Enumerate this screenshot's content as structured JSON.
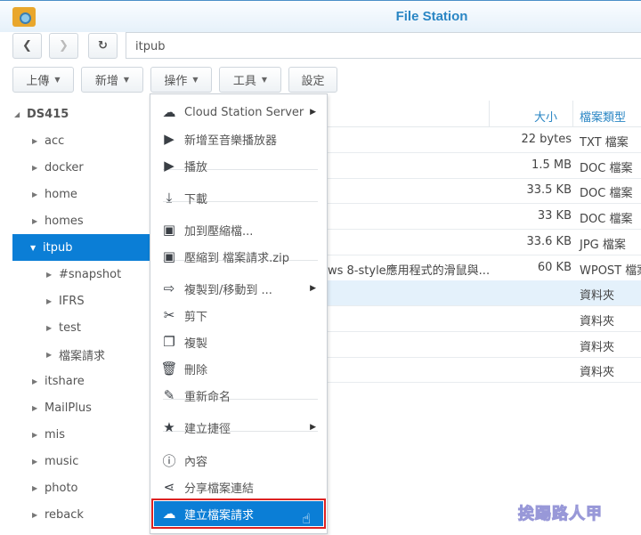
{
  "window": {
    "title": "File Station"
  },
  "nav": {
    "path": "itpub"
  },
  "toolbar": {
    "upload": "上傳",
    "create": "新增",
    "action": "操作",
    "tools": "工具",
    "settings": "設定"
  },
  "tree": {
    "root": "DS415",
    "items": [
      "acc",
      "docker",
      "home",
      "homes",
      "itpub",
      "#snapshot",
      "IFRS",
      "test",
      "檔案請求",
      "itshare",
      "MailPlus",
      "mis",
      "music",
      "photo",
      "reback"
    ]
  },
  "grid": {
    "headers": {
      "size": "大小",
      "type": "檔案類型"
    },
    "rows": [
      {
        "name": "",
        "size": "22 bytes",
        "type": "TXT 檔案"
      },
      {
        "name": "",
        "size": "1.5 MB",
        "type": "DOC 檔案"
      },
      {
        "name": "",
        "size": "33.5 KB",
        "type": "DOC 檔案"
      },
      {
        "name": "",
        "size": "33 KB",
        "type": "DOC 檔案"
      },
      {
        "name": "",
        "size": "33.6 KB",
        "type": "JPG 檔案"
      },
      {
        "name": "ws 8-style應用程式的滑鼠與...",
        "size": "60 KB",
        "type": "WPOST 檔案"
      },
      {
        "name": "",
        "size": "",
        "type": "資料夾"
      },
      {
        "name": "",
        "size": "",
        "type": "資料夾"
      },
      {
        "name": "",
        "size": "",
        "type": "資料夾"
      },
      {
        "name": "",
        "size": "",
        "type": "資料夾"
      }
    ]
  },
  "menu": {
    "items": [
      "Cloud Station Server",
      "新增至音樂播放器",
      "播放",
      "下載",
      "加到壓縮檔...",
      "壓縮到 檔案請求.zip",
      "複製到/移動到 ...",
      "剪下",
      "複製",
      "刪除",
      "重新命名",
      "建立捷徑",
      "內容",
      "分享檔案連結",
      "建立檔案請求"
    ]
  },
  "watermark": "挨踢路人甲",
  "colors": {
    "accent": "#0b7ed6",
    "title": "#2a86c4",
    "highlight_border": "#dd2222"
  }
}
